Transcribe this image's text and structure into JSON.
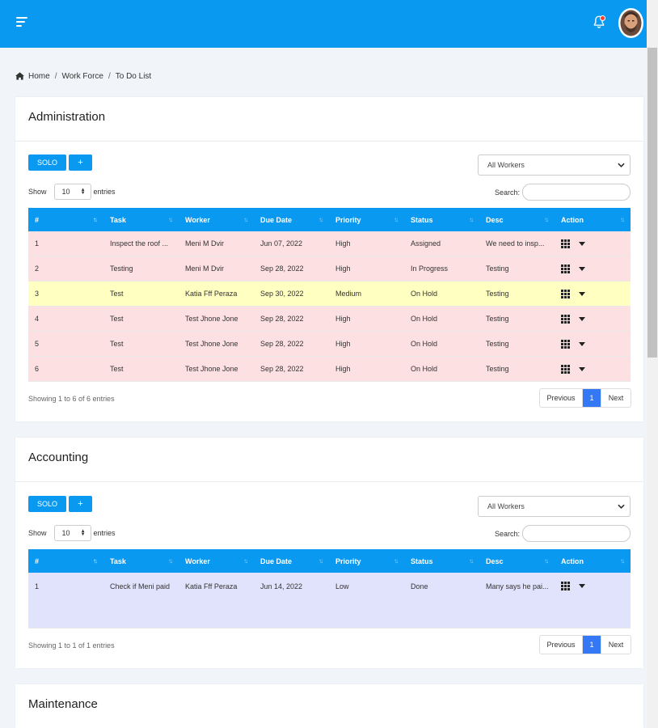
{
  "header": {
    "menu_icon": "menu-icon",
    "bell_icon": "bell-icon",
    "avatar": "user-avatar"
  },
  "breadcrumb": [
    "Home",
    "Work Force",
    "To Do List"
  ],
  "columns": [
    "#",
    "Task",
    "Worker",
    "Due Date",
    "Priority",
    "Status",
    "Desc",
    "Action"
  ],
  "colors": {
    "accent": "#0a99f0",
    "high": "#fde0e2",
    "medium": "#ffffc2",
    "low": "#e1e2fb",
    "page_active": "#3578f6"
  },
  "sections": [
    {
      "title": "Administration",
      "solo_label": "SOLO",
      "add_label": "+",
      "worker_filter": "All Workers",
      "show_label": "Show",
      "page_length": "10",
      "entries_label": "entries",
      "search_label": "Search:",
      "rows": [
        {
          "num": "1",
          "task": "Inspect the roof ...",
          "worker": "Meni M Dvir",
          "due": "Jun 07, 2022",
          "priority": "High",
          "status": "Assigned",
          "desc": "We need to insp...",
          "level": "high"
        },
        {
          "num": "2",
          "task": "Testing",
          "worker": "Meni M Dvir",
          "due": "Sep 28, 2022",
          "priority": "High",
          "status": "In Progress",
          "desc": "Testing",
          "level": "high"
        },
        {
          "num": "3",
          "task": "Test",
          "worker": "Katia Fff Peraza",
          "due": "Sep 30, 2022",
          "priority": "Medium",
          "status": "On Hold",
          "desc": "Testing",
          "level": "medium"
        },
        {
          "num": "4",
          "task": "Test",
          "worker": "Test Jhone Jone",
          "due": "Sep 28, 2022",
          "priority": "High",
          "status": "On Hold",
          "desc": "Testing",
          "level": "high"
        },
        {
          "num": "5",
          "task": "Test",
          "worker": "Test Jhone Jone",
          "due": "Sep 28, 2022",
          "priority": "High",
          "status": "On Hold",
          "desc": "Testing",
          "level": "high"
        },
        {
          "num": "6",
          "task": "Test",
          "worker": "Test Jhone Jone",
          "due": "Sep 28, 2022",
          "priority": "High",
          "status": "On Hold",
          "desc": "Testing",
          "level": "high"
        }
      ],
      "info": "Showing 1 to 6 of 6 entries",
      "pager": {
        "prev": "Previous",
        "page": "1",
        "next": "Next"
      }
    },
    {
      "title": "Accounting",
      "solo_label": "SOLO",
      "add_label": "+",
      "worker_filter": "All Workers",
      "show_label": "Show",
      "page_length": "10",
      "entries_label": "entries",
      "search_label": "Search:",
      "rows": [
        {
          "num": "1",
          "task": "Check if Meni paid",
          "worker": "Katia Fff Peraza",
          "due": "Jun 14, 2022",
          "priority": "Low",
          "status": "Done",
          "desc": "Many says he pai...",
          "level": "low"
        }
      ],
      "info": "Showing 1 to 1 of 1 entries",
      "pager": {
        "prev": "Previous",
        "page": "1",
        "next": "Next"
      }
    },
    {
      "title": "Maintenance"
    }
  ]
}
